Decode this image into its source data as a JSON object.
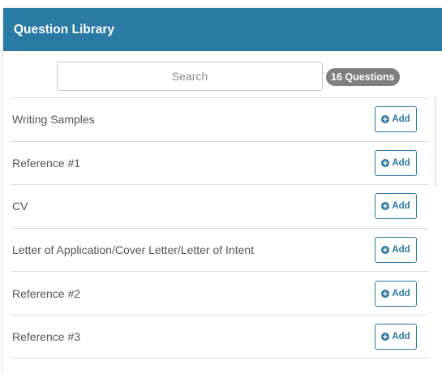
{
  "header": {
    "title": "Question Library"
  },
  "search": {
    "placeholder": "Search",
    "value": ""
  },
  "badge": {
    "count_label": "16 Questions"
  },
  "colors": {
    "header_bg": "#2a7aa3",
    "accent": "#2a7aa3",
    "badge_bg": "#7e7e7e"
  },
  "list": {
    "items": [
      {
        "label": "Writing Samples",
        "button": "Add",
        "icon": "plus-circle-icon"
      },
      {
        "label": "Reference #1",
        "button": "Add",
        "icon": "plus-circle-icon"
      },
      {
        "label": "CV",
        "button": "Add",
        "icon": "plus-circle-icon"
      },
      {
        "label": "Letter of Application/Cover Letter/Letter of Intent",
        "button": "Add",
        "icon": "plus-circle-icon"
      },
      {
        "label": "Reference #2",
        "button": "Add",
        "icon": "plus-circle-icon"
      },
      {
        "label": "Reference #3",
        "button": "Add",
        "icon": "plus-circle-icon"
      }
    ]
  }
}
